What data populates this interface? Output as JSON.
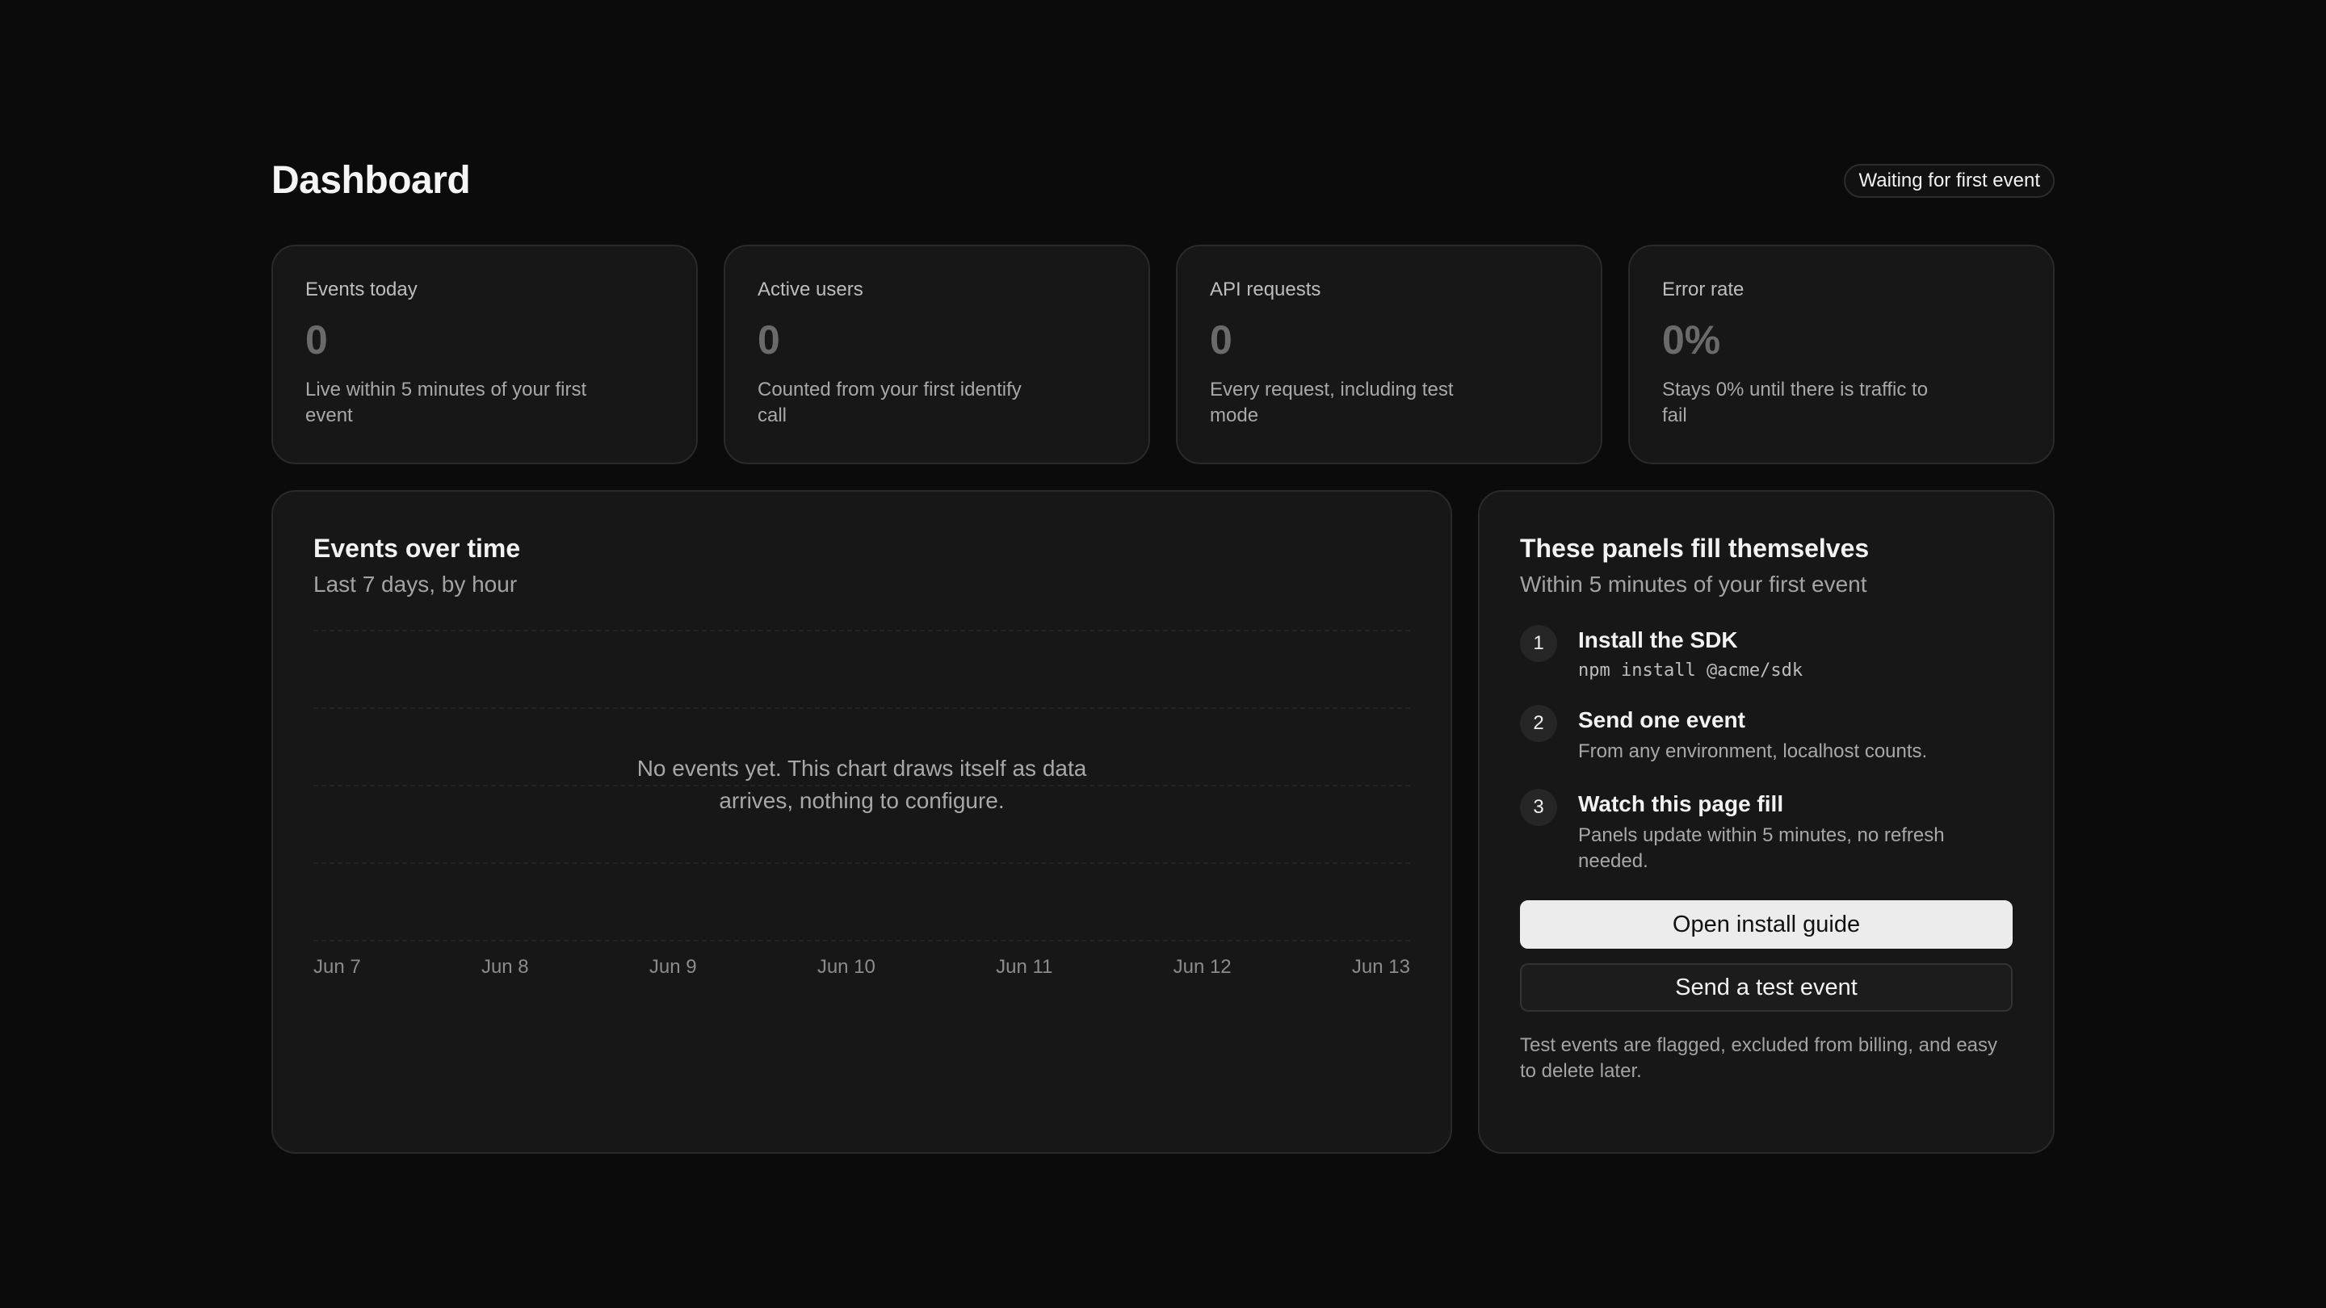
{
  "header": {
    "title": "Dashboard",
    "status": "Waiting for first event"
  },
  "stats": [
    {
      "label": "Events today",
      "value": "0",
      "desc": "Live within 5 minutes of your first event"
    },
    {
      "label": "Active users",
      "value": "0",
      "desc": "Counted from your first identify call"
    },
    {
      "label": "API requests",
      "value": "0",
      "desc": "Every request, including test mode"
    },
    {
      "label": "Error rate",
      "value": "0%",
      "desc": "Stays 0% until there is traffic to fail"
    }
  ],
  "chart_panel": {
    "title": "Events over time",
    "subtitle": "Last 7 days, by hour",
    "empty_line1": "No events yet. This chart draws itself as data",
    "empty_line2": "arrives, nothing to configure."
  },
  "chart_data": {
    "type": "line",
    "title": "Events over time",
    "subtitle": "Last 7 days, by hour",
    "categories": [
      "Jun 7",
      "Jun 8",
      "Jun 9",
      "Jun 10",
      "Jun 11",
      "Jun 12",
      "Jun 13"
    ],
    "series": [],
    "grid": true
  },
  "guide": {
    "title": "These panels fill themselves",
    "subtitle": "Within 5 minutes of your first event",
    "steps": [
      {
        "num": "1",
        "title": "Install the SDK",
        "desc": "npm install @acme/sdk"
      },
      {
        "num": "2",
        "title": "Send one event",
        "desc": "From any environment, localhost counts."
      },
      {
        "num": "3",
        "title": "Watch this page fill",
        "desc": "Panels update within 5 minutes, no refresh needed."
      }
    ],
    "primary_button": "Open install guide",
    "secondary_button": "Send a test event",
    "footnote": "Test events are flagged, excluded from billing, and easy to delete later."
  }
}
